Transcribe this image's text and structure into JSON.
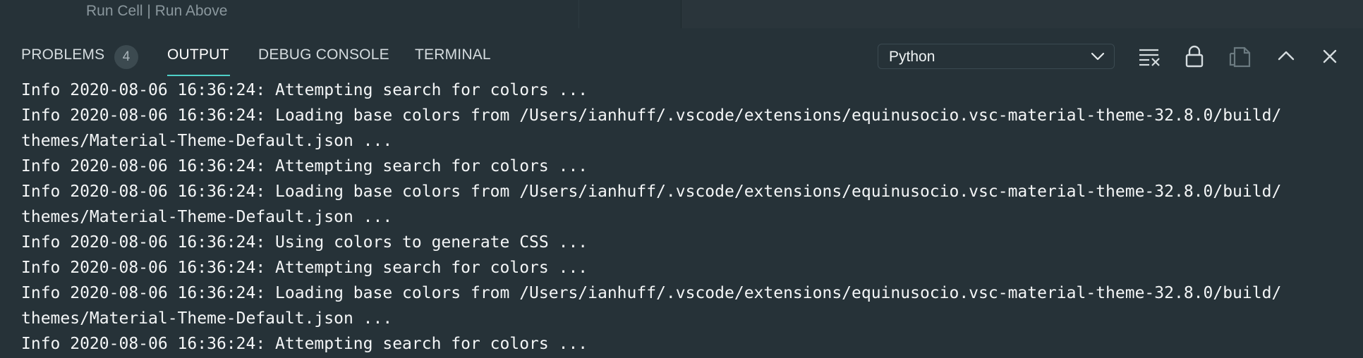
{
  "editor": {
    "codelens": {
      "run_cell": "Run Cell",
      "separator": " | ",
      "run_above": "Run Above"
    }
  },
  "panel": {
    "tabs": [
      {
        "label": "PROBLEMS",
        "active": false
      },
      {
        "label": "OUTPUT",
        "active": true
      },
      {
        "label": "DEBUG CONSOLE",
        "active": false
      },
      {
        "label": "TERMINAL",
        "active": false
      }
    ],
    "problems_count": "4",
    "channel_select": {
      "value": "Python"
    },
    "toolbar": {
      "icons": [
        "clear-output-icon",
        "lock-scroll-icon",
        "open-log-icon",
        "maximize-panel-icon",
        "close-panel-icon"
      ]
    },
    "output_lines": [
      "Info 2020-08-06 16:36:24: Attempting search for colors ...",
      "Info 2020-08-06 16:36:24: Loading base colors from /Users/ianhuff/.vscode/extensions/equinusocio.vsc-material-theme-32.8.0/build/",
      "themes/Material-Theme-Default.json ...",
      "Info 2020-08-06 16:36:24: Attempting search for colors ...",
      "Info 2020-08-06 16:36:24: Loading base colors from /Users/ianhuff/.vscode/extensions/equinusocio.vsc-material-theme-32.8.0/build/",
      "themes/Material-Theme-Default.json ...",
      "Info 2020-08-06 16:36:24: Using colors to generate CSS ...",
      "Info 2020-08-06 16:36:24: Attempting search for colors ...",
      "Info 2020-08-06 16:36:24: Loading base colors from /Users/ianhuff/.vscode/extensions/equinusocio.vsc-material-theme-32.8.0/build/",
      "themes/Material-Theme-Default.json ...",
      "Info 2020-08-06 16:36:24: Attempting search for colors ..."
    ]
  },
  "colors": {
    "background": "#263238",
    "accent": "#4fd0c8",
    "text": "#f4f6f7",
    "muted": "#8a979d"
  }
}
